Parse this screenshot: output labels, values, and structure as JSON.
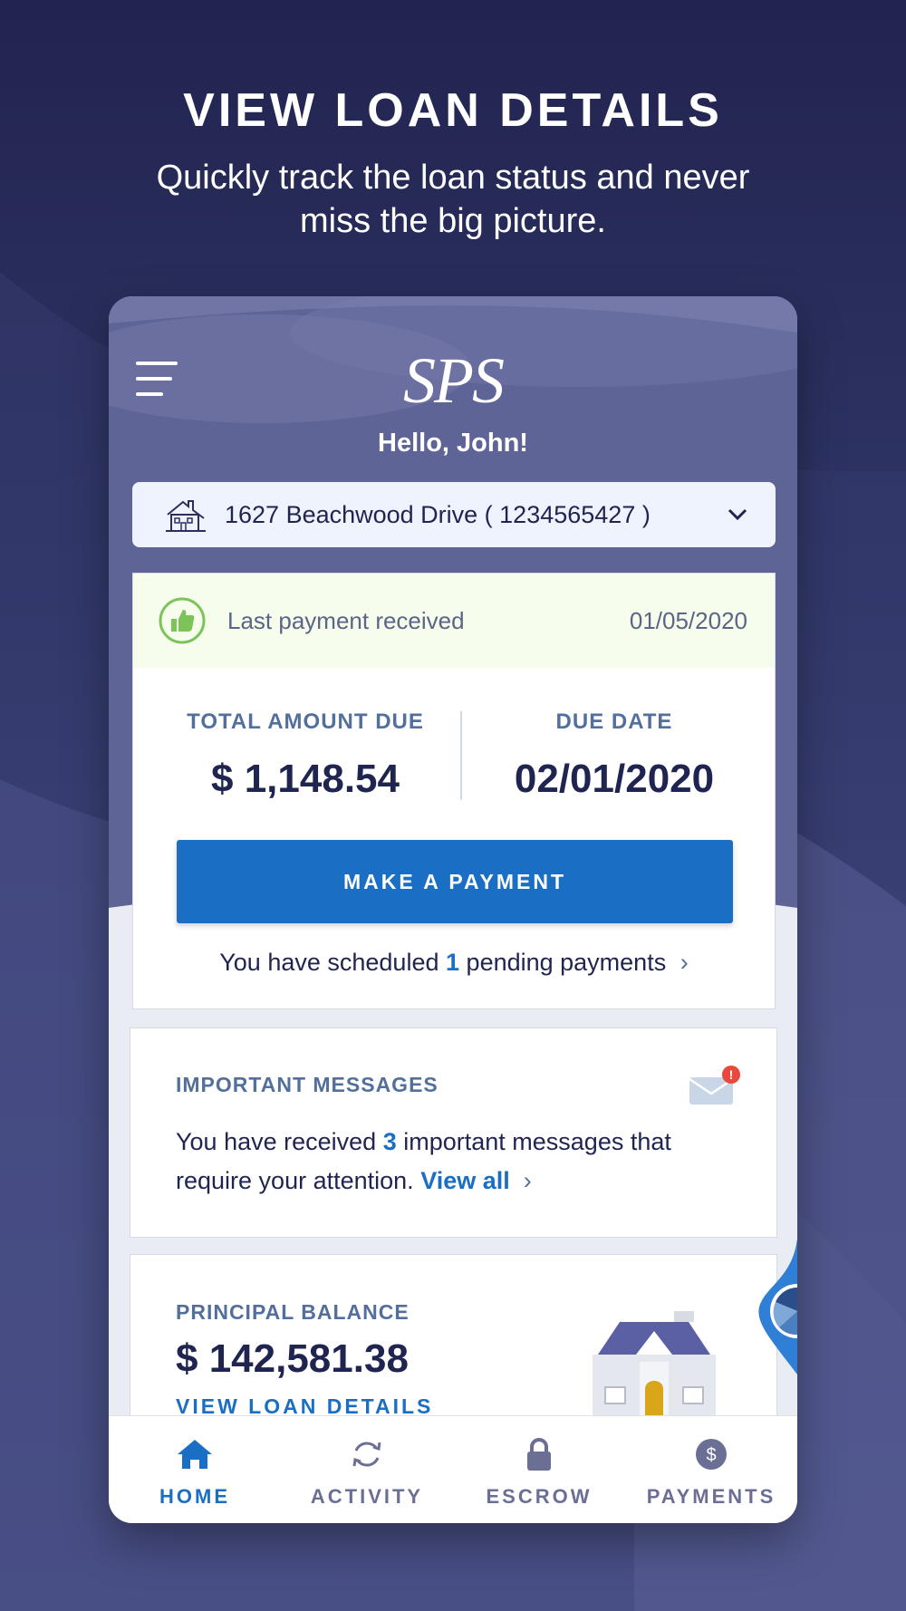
{
  "promo": {
    "title": "VIEW LOAN DETAILS",
    "subtitle": "Quickly track the loan status and never miss the big picture."
  },
  "app": {
    "logo": "SPS",
    "greeting": "Hello, John!"
  },
  "property": {
    "address": "1627 Beachwood Drive ( 1234565427 )"
  },
  "last_payment": {
    "label": "Last payment received",
    "date": "01/05/2020"
  },
  "due": {
    "amount_label": "TOTAL AMOUNT DUE",
    "amount": "$ 1,148.54",
    "date_label": "DUE DATE",
    "date": "02/01/2020",
    "pay_button": "MAKE A PAYMENT",
    "pending_prefix": "You have scheduled",
    "pending_count": "1",
    "pending_suffix": "pending payments",
    "pending_arrow": "›"
  },
  "messages": {
    "title": "IMPORTANT MESSAGES",
    "badge": "!",
    "text_prefix": "You have received",
    "count": "3",
    "text_suffix": "important messages that require your attention.",
    "view_all": "View all",
    "view_all_arrow": "›"
  },
  "balance": {
    "title": "PRINCIPAL BALANCE",
    "value": "$ 142,581.38",
    "link": "VIEW LOAN DETAILS"
  },
  "nav": {
    "home": "HOME",
    "activity": "ACTIVITY",
    "escrow": "ESCROW",
    "payments": "PAYMENTS"
  },
  "colors": {
    "accent": "#1a6fc4",
    "header": "#5f6497",
    "label": "#53709c",
    "text": "#1f2550",
    "success": "#7cc35a"
  }
}
